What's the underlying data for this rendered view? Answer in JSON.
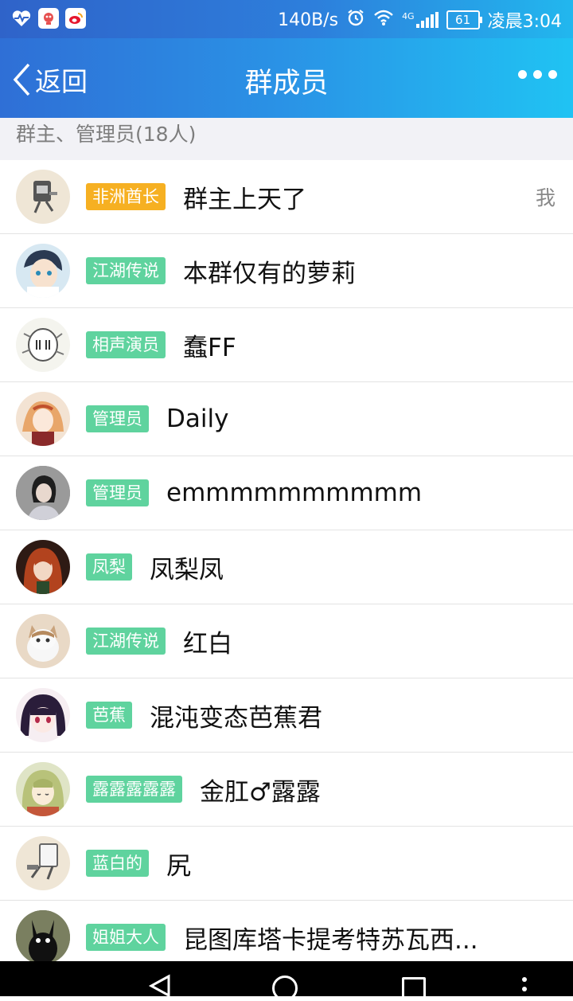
{
  "statusbar": {
    "net_speed": "140B/s",
    "network_type": "4G",
    "battery": "61",
    "time": "凌晨3:04",
    "icons": [
      "heart-monitor-icon",
      "app-notification-icon",
      "weibo-icon",
      "alarm-icon",
      "wifi-icon",
      "signal-icon",
      "battery-icon"
    ]
  },
  "header": {
    "back_label": "返回",
    "title": "群成员",
    "more_icon": "more-dots-icon"
  },
  "section": {
    "label": "群主、管理员(18人)"
  },
  "members": [
    {
      "badge": "非洲酋长",
      "name": "群主上天了",
      "me": "我",
      "badge_color": "#f6b022"
    },
    {
      "badge": "江湖传说",
      "name": "本群仅有的萝莉",
      "badge_color": "#5fd39e"
    },
    {
      "badge": "相声演员",
      "name": "蠢FF",
      "badge_color": "#5fd39e"
    },
    {
      "badge": "管理员",
      "name": "Daily",
      "badge_color": "#5fd39e"
    },
    {
      "badge": "管理员",
      "name": "emmmmmmmmmm",
      "badge_color": "#5fd39e"
    },
    {
      "badge": "凤梨",
      "name": "凤梨凤",
      "badge_color": "#5fd39e"
    },
    {
      "badge": "江湖传说",
      "name": "红白",
      "badge_color": "#5fd39e"
    },
    {
      "badge": "芭蕉",
      "name": "混沌变态芭蕉君",
      "badge_color": "#5fd39e"
    },
    {
      "badge": "露露露露露",
      "name": "金肛♂露露",
      "badge_color": "#5fd39e"
    },
    {
      "badge": "蓝白的",
      "name": "尻",
      "badge_color": "#5fd39e"
    },
    {
      "badge": "姐姐大人",
      "name": "昆图库塔卡提考特苏瓦西...",
      "badge_color": "#5fd39e"
    }
  ],
  "colors": {
    "header_start": "#2f6fd6",
    "header_end": "#20c3f3",
    "owner_badge": "#f6b022",
    "member_badge": "#5fd39e"
  }
}
